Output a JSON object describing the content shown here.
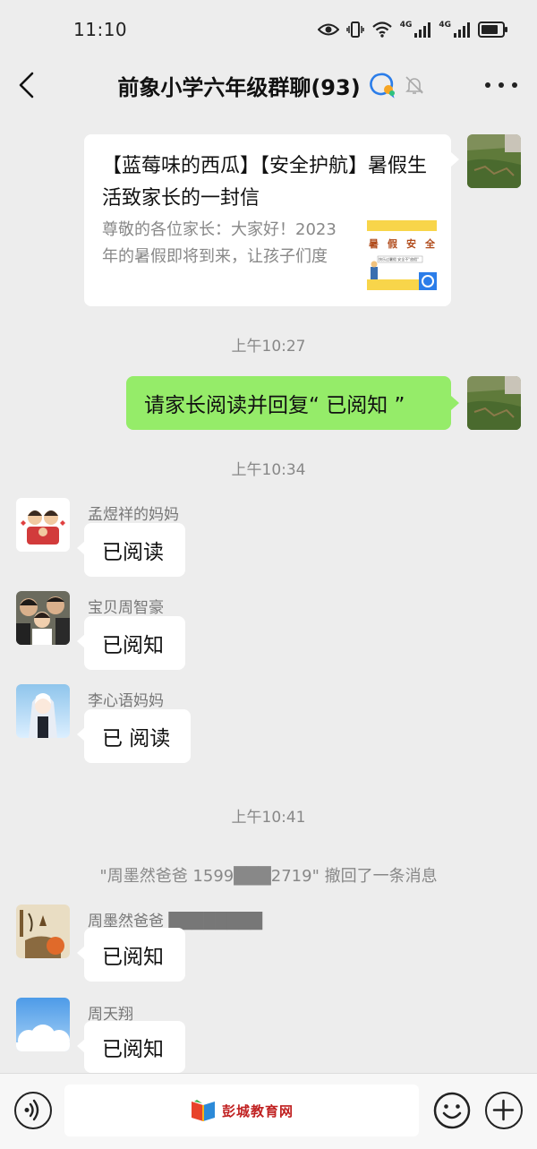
{
  "status_bar": {
    "time": "11:10",
    "network_label_1": "4G",
    "network_label_2": "4G"
  },
  "header": {
    "title": "前象小学六年级群聊(93)"
  },
  "messages": {
    "link_card": {
      "title": "【蓝莓味的西瓜】【安全护航】暑假生活致家长的一封信",
      "description": "尊敬的各位家长：大家好！2023年的暑假即将到来，让孩子们度",
      "thumb_chars": [
        "暑",
        "假",
        "安",
        "全"
      ],
      "thumb_subtext": "快乐过暑假 安全不\"放假\""
    },
    "time_1": "上午10:27",
    "outgoing_text": "请家长阅读并回复“ 已阅知 ”",
    "time_2": "上午10:34",
    "msg_1": {
      "sender": "孟煜祥的妈妈",
      "text": "已阅读"
    },
    "msg_2": {
      "sender": "宝贝周智豪",
      "text": "已阅知"
    },
    "msg_3": {
      "sender": "李心语妈妈",
      "text": "已 阅读"
    },
    "time_3": "上午10:41",
    "recall_notice": "\"周墨然爸爸 1599███2719\" 撤回了一条消息",
    "msg_4": {
      "sender": "周墨然爸爸 ████████",
      "text": "已阅知"
    },
    "msg_5": {
      "sender": "周天翔",
      "text": "已阅知"
    }
  },
  "bottom_bar": {
    "watermark_text": "彭城教育网"
  },
  "colors": {
    "background": "#ededed",
    "outgoing_bubble": "#95ec69",
    "incoming_bubble": "#ffffff",
    "watermark": "#c02020"
  }
}
